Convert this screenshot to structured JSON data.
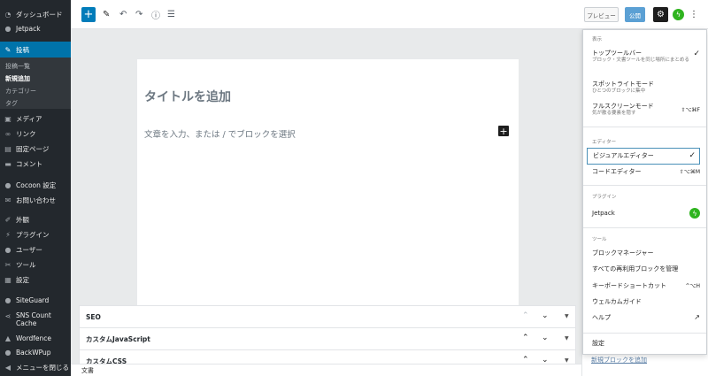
{
  "sidebar": {
    "items": [
      {
        "label": "ダッシュボード",
        "icon": "dashboard-icon"
      },
      {
        "label": "Jetpack",
        "icon": "jetpack-icon"
      },
      {
        "label": "投稿",
        "icon": "pin-icon"
      },
      {
        "label": "メディア",
        "icon": "media-icon"
      },
      {
        "label": "リンク",
        "icon": "link-icon"
      },
      {
        "label": "固定ページ",
        "icon": "page-icon"
      },
      {
        "label": "コメント",
        "icon": "comment-icon"
      },
      {
        "label": "Cocoon 設定",
        "icon": "cocoon-icon"
      },
      {
        "label": "お問い合わせ",
        "icon": "mail-icon"
      },
      {
        "label": "外観",
        "icon": "brush-icon"
      },
      {
        "label": "プラグイン",
        "icon": "plugin-icon"
      },
      {
        "label": "ユーザー",
        "icon": "user-icon"
      },
      {
        "label": "ツール",
        "icon": "wrench-icon"
      },
      {
        "label": "設定",
        "icon": "settings-icon"
      },
      {
        "label": "SiteGuard",
        "icon": "siteguard-icon"
      },
      {
        "label": "SNS Count Cache",
        "icon": "share-icon"
      },
      {
        "label": "Wordfence",
        "icon": "wordfence-icon"
      },
      {
        "label": "BackWPup",
        "icon": "backwpup-icon"
      },
      {
        "label": "メニューを閉じる",
        "icon": "collapse-icon"
      }
    ],
    "submenu": [
      "投稿一覧",
      "新規追加",
      "カテゴリー",
      "タグ"
    ]
  },
  "toolbar": {
    "add_label": "+",
    "preview_label": "プレビュー",
    "publish_label": "公開"
  },
  "editor": {
    "title_placeholder": "タイトルを追加",
    "body_placeholder": "文章を入力、または / でブロックを選択"
  },
  "metaboxes": [
    "SEO",
    "カスタムJavaScript",
    "カスタムCSS"
  ],
  "footer": {
    "breadcrumb": "文書",
    "under_link": "新規ブロックを追加"
  },
  "dropdown": {
    "view": {
      "heading": "表示",
      "items": [
        {
          "title": "トップツールバー",
          "desc": "ブロック・文書ツールを同じ場所にまとめる",
          "checked": true
        },
        {
          "title": "スポットライトモード",
          "desc": "ひとつのブロックに集中"
        },
        {
          "title": "フルスクリーンモード",
          "desc": "気が散る要素を隠す",
          "shortcut": "⇧⌥⌘F"
        }
      ]
    },
    "editor": {
      "heading": "エディター",
      "items": [
        {
          "title": "ビジュアルエディター",
          "checked": true
        },
        {
          "title": "コードエディター",
          "shortcut": "⇧⌥⌘M"
        }
      ]
    },
    "plugins": {
      "heading": "プラグイン",
      "items": [
        {
          "title": "Jetpack"
        }
      ]
    },
    "tools": {
      "heading": "ツール",
      "items": [
        {
          "title": "ブロックマネージャー"
        },
        {
          "title": "すべての再利用ブロックを管理"
        },
        {
          "title": "キーボードショートカット",
          "shortcut": "^⌥H"
        },
        {
          "title": "ウェルカムガイド"
        },
        {
          "title": "ヘルプ"
        }
      ]
    },
    "bottom": {
      "title": "設定"
    }
  }
}
